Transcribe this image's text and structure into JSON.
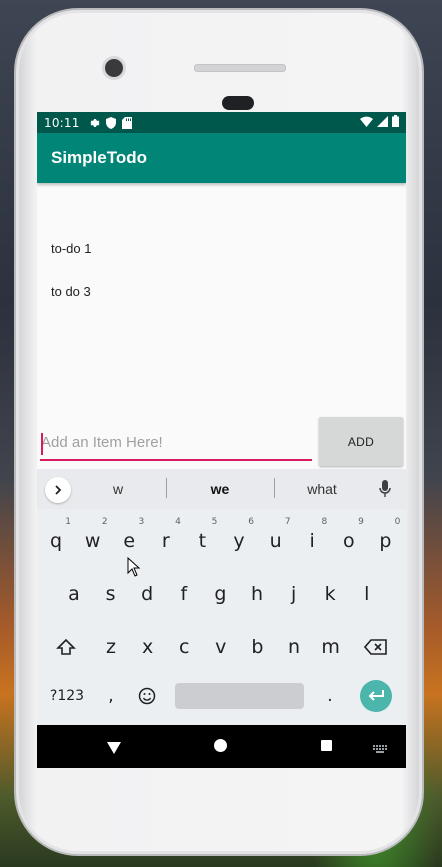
{
  "status_bar": {
    "time": "10:11",
    "icons": [
      "settings-icon",
      "shield-icon",
      "sd-card-icon",
      "wifi-icon",
      "signal-icon",
      "battery-icon"
    ]
  },
  "app_bar": {
    "title": "SimpleTodo"
  },
  "todo_list": {
    "items": [
      "to-do 1",
      "to do 3"
    ]
  },
  "input": {
    "placeholder": "Add an Item Here!",
    "value": ""
  },
  "add_button": {
    "label": "ADD"
  },
  "keyboard": {
    "suggestions": [
      "w",
      "we",
      "what"
    ],
    "row1": [
      "q",
      "w",
      "e",
      "r",
      "t",
      "y",
      "u",
      "i",
      "o",
      "p"
    ],
    "row1_hints": [
      "1",
      "2",
      "3",
      "4",
      "5",
      "6",
      "7",
      "8",
      "9",
      "0"
    ],
    "row2": [
      "a",
      "s",
      "d",
      "f",
      "g",
      "h",
      "j",
      "k",
      "l"
    ],
    "row3": [
      "z",
      "x",
      "c",
      "v",
      "b",
      "n",
      "m"
    ],
    "symbols_key": "?123",
    "comma_key": ",",
    "period_key": "."
  },
  "colors": {
    "status_bar": "#00574b",
    "app_bar": "#008577",
    "accent": "#d81b60",
    "enter_key": "#4db6ac"
  }
}
